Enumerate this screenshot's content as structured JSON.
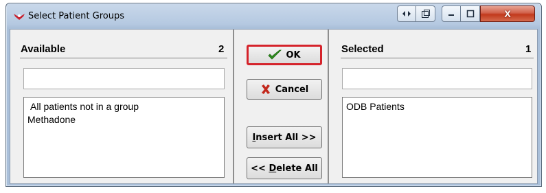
{
  "window": {
    "title": "Select Patient Groups",
    "close_label": "X"
  },
  "available": {
    "header": "Available",
    "count": "2",
    "filter_value": "",
    "items": [
      "All patients not in a group",
      "Methadone"
    ]
  },
  "selected": {
    "header": "Selected",
    "count": "1",
    "filter_value": "",
    "items": [
      "ODB Patients"
    ]
  },
  "buttons": {
    "ok": "OK",
    "cancel": "Cancel",
    "insert_all_u": "I",
    "insert_all_rest": "nsert All >>",
    "delete_all_prefix": "<< ",
    "delete_all_u": "D",
    "delete_all_rest": "elete All"
  },
  "colors": {
    "ok_border": "#d5232b",
    "ok_check": "#2e8b1e",
    "cancel_x": "#c2281c"
  }
}
